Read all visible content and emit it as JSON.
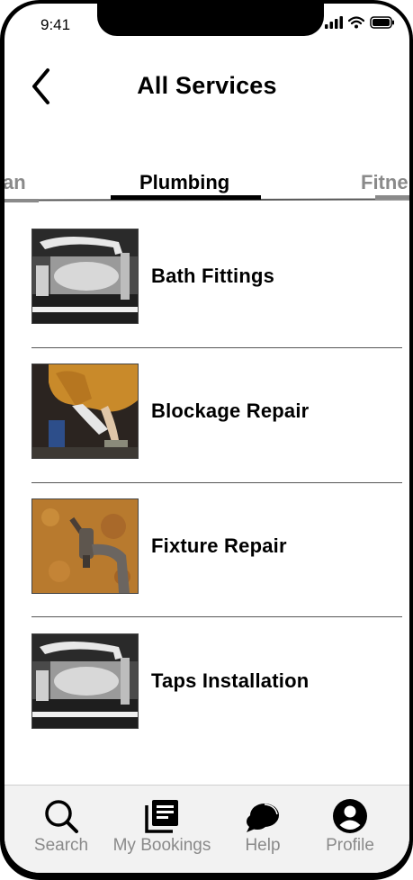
{
  "status_bar": {
    "time": "9:41"
  },
  "header": {
    "title": "All Services"
  },
  "tabs": {
    "left_partial": "an",
    "active": "Plumbing",
    "right_partial": "Fitne"
  },
  "services": [
    {
      "label": "Bath Fittings",
      "image": "chrome-faucet-photo"
    },
    {
      "label": "Blockage Repair",
      "image": "plumber-hands-photo"
    },
    {
      "label": "Fixture Repair",
      "image": "rusty-tap-photo"
    },
    {
      "label": "Taps Installation",
      "image": "chrome-faucet-photo"
    }
  ],
  "bottom_nav": {
    "items": [
      {
        "label": "Search",
        "icon": "search-icon"
      },
      {
        "label": "My Bookings",
        "icon": "bookings-icon"
      },
      {
        "label": "Help",
        "icon": "chat-bubble-icon"
      },
      {
        "label": "Profile",
        "icon": "profile-icon"
      }
    ]
  },
  "colors": {
    "inactive_gray": "#8a8a8a",
    "nav_background": "#f2f2f2",
    "text": "#000000"
  }
}
